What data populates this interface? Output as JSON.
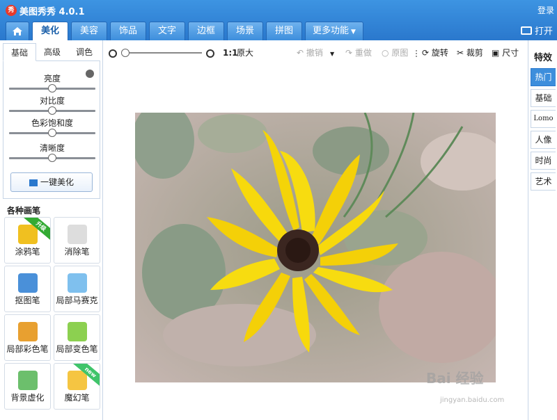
{
  "app": {
    "logo_char": "秀",
    "title": "美图秀秀 4.0.1",
    "login": "登录",
    "open": "打开"
  },
  "tabs": [
    {
      "label": "美化",
      "active": true
    },
    {
      "label": "美容"
    },
    {
      "label": "饰品"
    },
    {
      "label": "文字"
    },
    {
      "label": "边框"
    },
    {
      "label": "场景"
    },
    {
      "label": "拼图"
    },
    {
      "label": "更多功能"
    }
  ],
  "left": {
    "tabs": [
      {
        "label": "基础",
        "active": true
      },
      {
        "label": "高级"
      },
      {
        "label": "调色"
      }
    ],
    "sliders": [
      {
        "label": "亮度",
        "value": 0.5
      },
      {
        "label": "对比度",
        "value": 0.5
      },
      {
        "label": "色彩饱和度",
        "value": 0.5
      },
      {
        "label": "清晰度",
        "value": 0.5
      }
    ],
    "one_key": "一键美化",
    "brush_title": "各种画笔",
    "brushes": [
      {
        "label": "涂鸦笔",
        "badge": "升级",
        "color": "#f0c020"
      },
      {
        "label": "消除笔",
        "badge": "",
        "color": "#dddddd"
      },
      {
        "label": "抠图笔",
        "badge": "",
        "color": "#4a90d9"
      },
      {
        "label": "局部马赛克",
        "badge": "",
        "color": "#7fc0ee"
      },
      {
        "label": "局部彩色笔",
        "badge": "",
        "color": "#e8a030"
      },
      {
        "label": "局部变色笔",
        "badge": "",
        "color": "#8cd050"
      },
      {
        "label": "背景虚化",
        "badge": "",
        "color": "#6cbf6c"
      },
      {
        "label": "魔幻笔",
        "badge": "new",
        "color": "#f5c542"
      }
    ]
  },
  "toolbar": {
    "zoom_ratio": "1:1",
    "original": "原大",
    "undo": "撤销",
    "redo": "重做",
    "original_img": "原图",
    "rotate": "旋转",
    "crop": "裁剪",
    "size": "尺寸"
  },
  "right": {
    "title": "特效",
    "tabs": [
      {
        "label": "热门",
        "active": true
      },
      {
        "label": "基础"
      },
      {
        "label": "Lomo"
      },
      {
        "label": "人像"
      },
      {
        "label": "时尚"
      },
      {
        "label": "艺术"
      }
    ]
  },
  "watermark": {
    "text": "Bai 经验",
    "url": "jingyan.baidu.com"
  }
}
